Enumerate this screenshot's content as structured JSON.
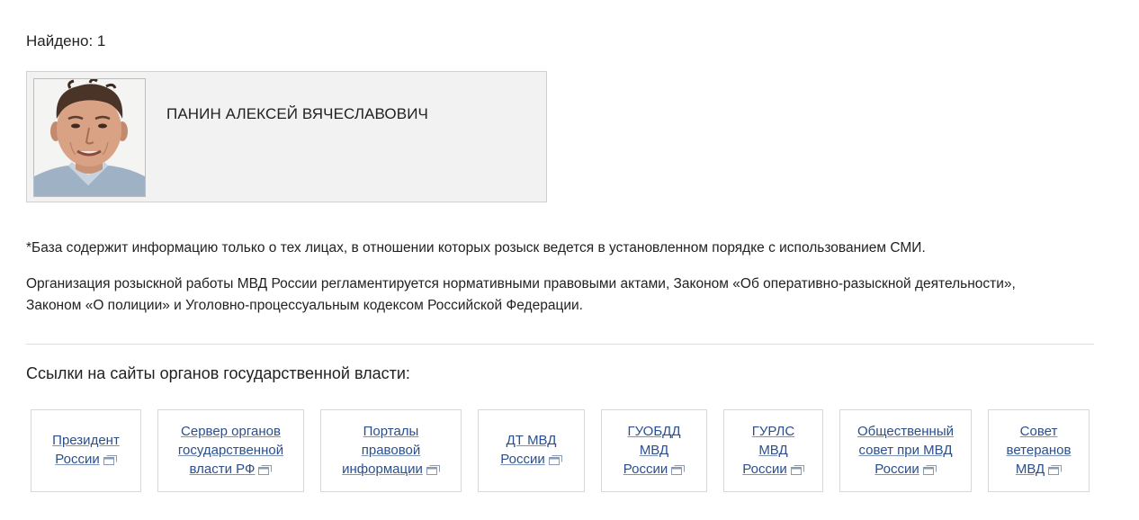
{
  "results": {
    "found_text": "Найдено: 1"
  },
  "person": {
    "name": "ПАНИН АЛЕКСЕЙ ВЯЧЕСЛАВОВИЧ"
  },
  "notes": {
    "database_note": "*База содержит информацию только о тех лицах, в отношении которых розыск ведется в установленном порядке с использованием СМИ.",
    "organization_line1": "Организация розыскной работы МВД России регламентируется нормативными правовыми актами, Законом «Об оперативно-разыскной деятельности»,",
    "organization_line2": "Законом «О полиции» и Уголовно-процессуальным кодексом Российской Федерации."
  },
  "links_section": {
    "title": "Ссылки на сайты органов государственной власти:",
    "external_icon": "external-window-icon",
    "link_color": "#2a4f8c",
    "items": [
      {
        "lines": [
          "Президент",
          "России"
        ]
      },
      {
        "lines": [
          "Сервер органов",
          "государственной",
          "власти РФ"
        ]
      },
      {
        "lines": [
          "Порталы",
          "правовой",
          "информации"
        ]
      },
      {
        "lines": [
          "ДТ МВД",
          "России"
        ]
      },
      {
        "lines": [
          "ГУОБДД",
          "МВД",
          "России"
        ]
      },
      {
        "lines": [
          "ГУРЛС",
          "МВД",
          "России"
        ]
      },
      {
        "lines": [
          "Общественный",
          "совет при МВД",
          "России"
        ]
      },
      {
        "lines": [
          "Совет",
          "ветеранов",
          "МВД"
        ]
      }
    ]
  }
}
